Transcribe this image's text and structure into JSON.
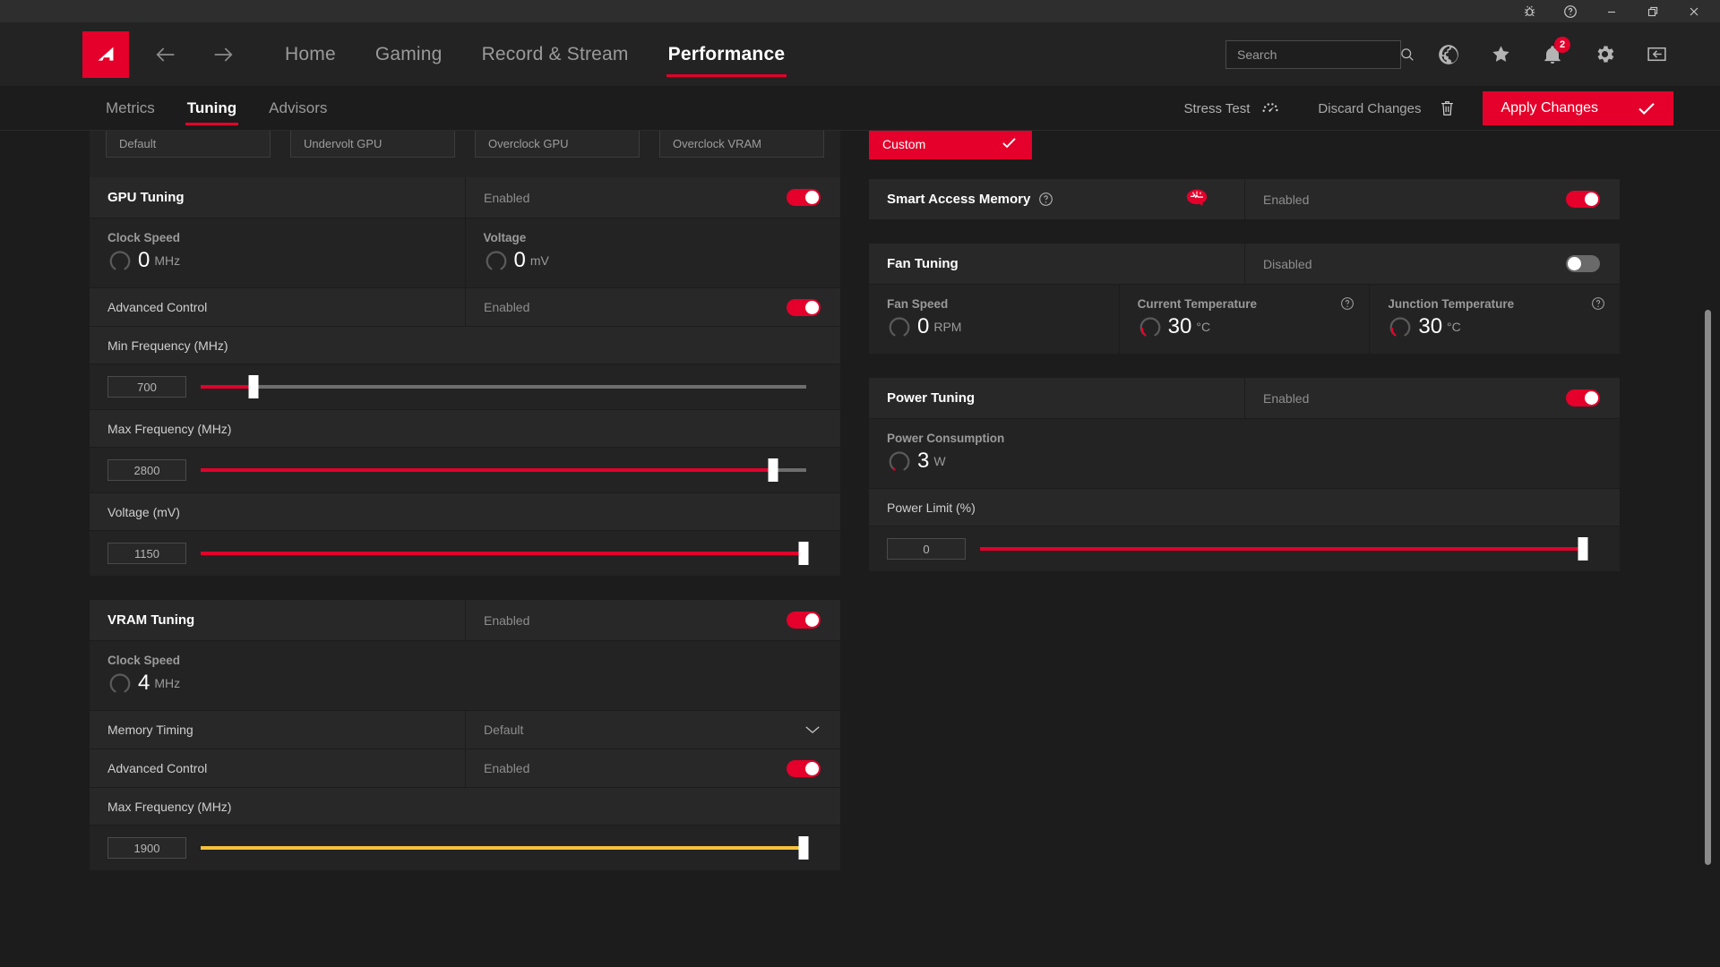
{
  "titlebar": {
    "buttons": [
      {
        "name": "bug-report",
        "icon": "bug-icon"
      },
      {
        "name": "help",
        "icon": "help-icon"
      },
      {
        "name": "minimize",
        "icon": "minimize-icon"
      },
      {
        "name": "restore",
        "icon": "restore-icon"
      },
      {
        "name": "close",
        "icon": "close-icon"
      }
    ]
  },
  "nav": {
    "logo_alt": "AMD",
    "back_icon": "arrow-left-icon",
    "forward_icon": "arrow-right-icon",
    "links": [
      {
        "label": "Home",
        "active": false
      },
      {
        "label": "Gaming",
        "active": false
      },
      {
        "label": "Record & Stream",
        "active": false
      },
      {
        "label": "Performance",
        "active": true
      }
    ],
    "search": {
      "placeholder": "Search",
      "value": "",
      "icon": "search-icon"
    },
    "icons": [
      {
        "name": "globe-icon",
        "badge": ""
      },
      {
        "name": "star-icon",
        "badge": ""
      },
      {
        "name": "bell-icon",
        "badge": "2"
      },
      {
        "name": "gear-icon",
        "badge": ""
      },
      {
        "name": "collapse-panel-icon",
        "badge": ""
      }
    ]
  },
  "subbar": {
    "tabs": [
      {
        "label": "Metrics",
        "active": false
      },
      {
        "label": "Tuning",
        "active": true
      },
      {
        "label": "Advisors",
        "active": false
      }
    ],
    "stress_test": "Stress Test",
    "discard": "Discard Changes",
    "apply": "Apply Changes"
  },
  "presets": {
    "items": [
      {
        "label": "Default",
        "selected": false
      },
      {
        "label": "Undervolt GPU",
        "selected": false
      },
      {
        "label": "Overclock GPU",
        "selected": false
      },
      {
        "label": "Overclock VRAM",
        "selected": false
      }
    ],
    "custom": {
      "label": "Custom",
      "selected": true
    }
  },
  "gpu_tuning": {
    "title": "GPU Tuning",
    "state_label": "Enabled",
    "state_on": true,
    "metrics": [
      {
        "label": "Clock Speed",
        "value": "0",
        "unit": "MHz",
        "gauge_pct": 0
      },
      {
        "label": "Voltage",
        "value": "0",
        "unit": "mV",
        "gauge_pct": 0
      }
    ],
    "advanced_control": {
      "label": "Advanced Control",
      "state_label": "Enabled",
      "state_on": true
    },
    "sliders": [
      {
        "label": "Min Frequency (MHz)",
        "value": "700",
        "pct": 8.7,
        "color": "#e4002b"
      },
      {
        "label": "Max Frequency (MHz)",
        "value": "2800",
        "pct": 94.5,
        "color": "#e4002b"
      },
      {
        "label": "Voltage (mV)",
        "value": "1150",
        "pct": 99.5,
        "color": "#e4002b"
      }
    ]
  },
  "vram_tuning": {
    "title": "VRAM Tuning",
    "state_label": "Enabled",
    "state_on": true,
    "metrics": [
      {
        "label": "Clock Speed",
        "value": "4",
        "unit": "MHz",
        "gauge_pct": 0
      }
    ],
    "memory_timing": {
      "label": "Memory Timing",
      "value": "Default",
      "icon": "chevron-down-icon"
    },
    "advanced_control": {
      "label": "Advanced Control",
      "state_label": "Enabled",
      "state_on": true
    },
    "sliders": [
      {
        "label": "Max Frequency (MHz)",
        "value": "1900",
        "pct": 99.5,
        "color": "#f5c13a"
      }
    ]
  },
  "smart_access_memory": {
    "title": "Smart Access Memory",
    "help_icon": "help-circle-icon",
    "brand_icon": "brain-icon",
    "state_label": "Enabled",
    "state_on": true
  },
  "fan_tuning": {
    "title": "Fan Tuning",
    "state_label": "Disabled",
    "state_on": false,
    "metrics": [
      {
        "label": "Fan Speed",
        "value": "0",
        "unit": "RPM",
        "gauge_pct": 0,
        "help": false
      },
      {
        "label": "Current Temperature",
        "value": "30",
        "unit": "°C",
        "gauge_pct": 18,
        "help": true
      },
      {
        "label": "Junction Temperature",
        "value": "30",
        "unit": "°C",
        "gauge_pct": 18,
        "help": true
      }
    ]
  },
  "power_tuning": {
    "title": "Power Tuning",
    "state_label": "Enabled",
    "state_on": true,
    "metrics": [
      {
        "label": "Power Consumption",
        "value": "3",
        "unit": "W",
        "gauge_pct": 3
      }
    ],
    "sliders": [
      {
        "label": "Power Limit (%)",
        "value": "0",
        "pct": 99.5,
        "color": "#e4002b"
      }
    ]
  },
  "colors": {
    "accent": "#e4002b",
    "yellow": "#f5c13a",
    "panel": "#282828",
    "panel_dark": "#232323",
    "background": "#1c1c1c"
  }
}
